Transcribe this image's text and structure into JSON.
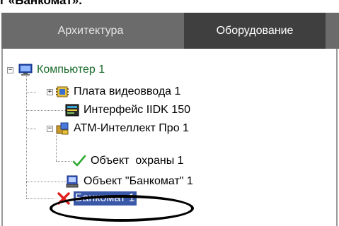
{
  "caption": "г «Банкомат».",
  "tabs": [
    {
      "label": "Архитектура",
      "active": false
    },
    {
      "label": "Оборудование",
      "active": true
    }
  ],
  "tree": {
    "root": {
      "label": "Компьютер 1",
      "icon": "computer-icon",
      "expanded": true
    },
    "items": [
      {
        "label": "Плата видеоввода 1",
        "icon": "video-board-icon",
        "expandable": true,
        "expanded": false
      },
      {
        "label": "Интерфейс IIDK 150",
        "icon": "interface-icon",
        "expandable": false
      },
      {
        "label": "ATM-Интеллект Про 1",
        "icon": "atm-intellect-icon",
        "expandable": true,
        "expanded": true
      },
      {
        "label": "Объект  охраны 1",
        "icon": "checkmark-icon",
        "expandable": false
      },
      {
        "label": "Объект \"Банкомат\" 1",
        "icon": "atm-object-icon",
        "expandable": false
      },
      {
        "label": "Банкомат 1",
        "icon": "red-cross-icon",
        "expandable": false,
        "selected": true
      }
    ]
  },
  "colors": {
    "tab_bar": "#6b6b6b",
    "active_tab": "#3f3f3f",
    "selection": "#3a58a8",
    "root_text": "#1a6a2a",
    "check_green": "#2eaa2e",
    "cross_red": "#e02020"
  }
}
